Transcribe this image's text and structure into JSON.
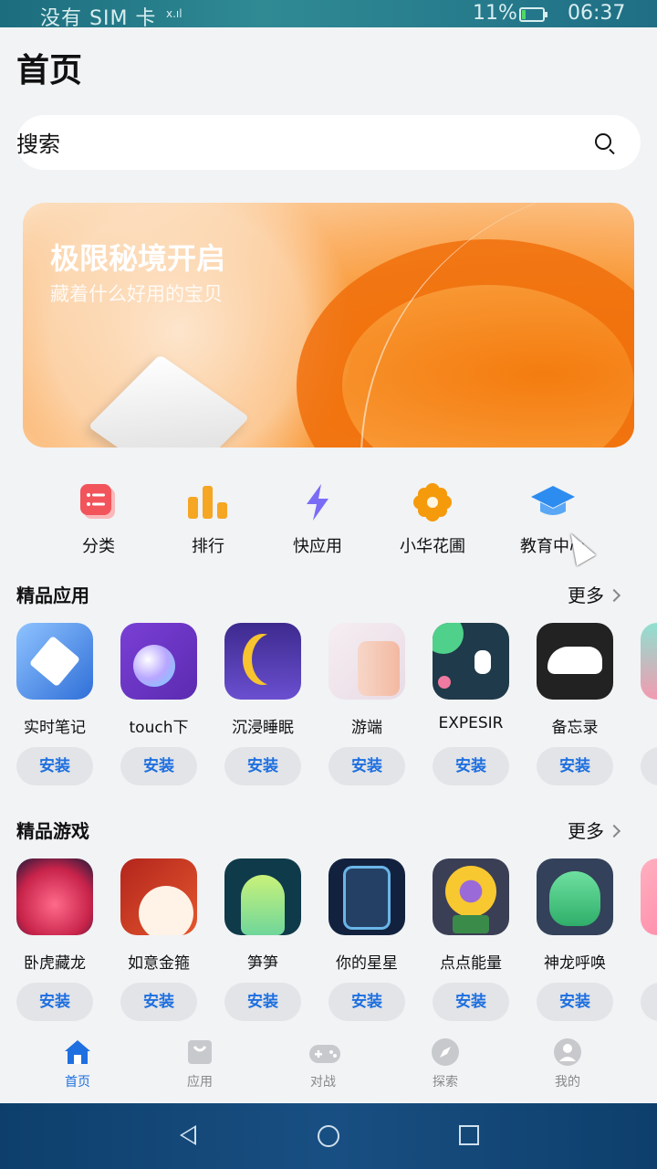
{
  "status_bar": {
    "sim": "没有 SIM 卡",
    "signal": "x.ıl",
    "battery": "11%",
    "time": "06:37"
  },
  "page_title": "首页",
  "search": {
    "placeholder": "搜索",
    "icon": "search-icon"
  },
  "banner": {
    "title": "极限秘境开启",
    "subtitle": "藏着什么好用的宝贝"
  },
  "quick_links": [
    {
      "label": "分类",
      "icon": "category-icon",
      "color": "#f2545b"
    },
    {
      "label": "排行",
      "icon": "ranking-icon",
      "color": "#f5a623"
    },
    {
      "label": "快应用",
      "icon": "lightning-icon",
      "color": "#7b6cf6"
    },
    {
      "label": "小华花圃",
      "icon": "flower-icon",
      "color": "#f59a0b"
    },
    {
      "label": "教育中心",
      "icon": "graduation-cap-icon",
      "color": "#2d8cf0"
    }
  ],
  "apps_section": {
    "title": "精品应用",
    "more": "更多",
    "items": [
      {
        "name": "实时笔记",
        "install": "安装"
      },
      {
        "name": "touch下",
        "install": "安装"
      },
      {
        "name": "沉浸睡眠",
        "install": "安装"
      },
      {
        "name": "游端",
        "install": "安装"
      },
      {
        "name": "EXPESIR",
        "install": "安装"
      },
      {
        "name": "备忘录",
        "install": "安装"
      }
    ]
  },
  "games_section": {
    "title": "精品游戏",
    "more": "更多",
    "items": [
      {
        "name": "卧虎藏龙",
        "install": "安装"
      },
      {
        "name": "如意金箍",
        "install": "安装"
      },
      {
        "name": "笋笋",
        "install": "安装"
      },
      {
        "name": "你的星星",
        "install": "安装"
      },
      {
        "name": "点点能量",
        "install": "安装"
      },
      {
        "name": "神龙呼唤",
        "install": "安装"
      }
    ]
  },
  "tabs": [
    {
      "label": "首页",
      "icon": "home-icon",
      "active": true
    },
    {
      "label": "应用",
      "icon": "apps-bag-icon",
      "active": false
    },
    {
      "label": "对战",
      "icon": "gamepad-icon",
      "active": false
    },
    {
      "label": "探索",
      "icon": "compass-icon",
      "active": false
    },
    {
      "label": "我的",
      "icon": "profile-icon",
      "active": false
    }
  ],
  "colors": {
    "accent": "#1e6fe0",
    "banner": "#f7891f"
  }
}
